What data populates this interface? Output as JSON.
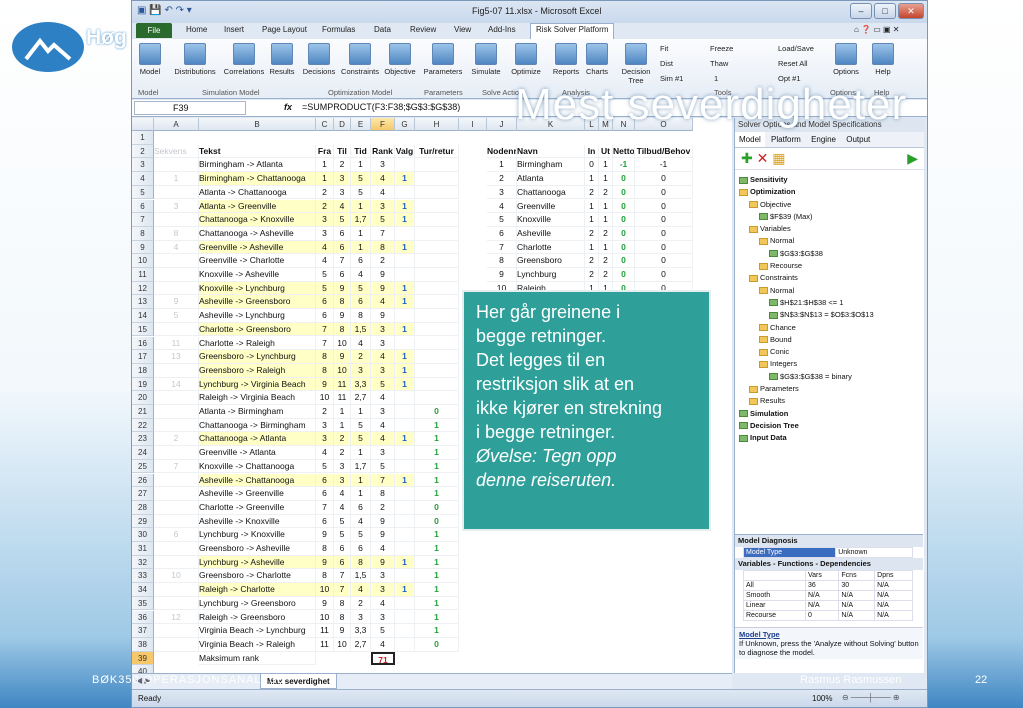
{
  "slide": {
    "brand": "Høg",
    "brand_sub": "Vitenskap",
    "title": "Mest severdigheter",
    "footer_left": "BØK350 OPERASJONSANALYSE",
    "footer_right": "Rasmus Rasmussen",
    "page": "22"
  },
  "window": {
    "title": "Fig5-07 11.xlsx - Microsoft Excel"
  },
  "tabs": [
    "File",
    "Home",
    "Insert",
    "Page Layout",
    "Formulas",
    "Data",
    "Review",
    "View",
    "Add-Ins",
    "Risk Solver Platform"
  ],
  "ribbon": {
    "buttons": [
      "Model",
      "Distributions",
      "Correlations",
      "Results",
      "Decisions",
      "Constraints",
      "Objective",
      "Parameters",
      "Simulate",
      "Optimize",
      "Reports",
      "Charts",
      "Decision Tree",
      "Options",
      "Help"
    ],
    "groups": [
      "Model",
      "Simulation Model",
      "Optimization Model",
      "Parameters",
      "Solve Action",
      "Analysis",
      "Tools",
      "Options",
      "Help"
    ],
    "small": [
      "Fit",
      "Dist",
      "Sim #1",
      "Freeze",
      "Thaw",
      "1",
      "Load/Save",
      "Reset All",
      "Opt #1"
    ]
  },
  "formula_bar": {
    "name_box": "F39",
    "formula": "=SUMPRODUCT(F3:F38;$G$3:$G$38)"
  },
  "columns": [
    "A",
    "B",
    "C",
    "D",
    "E",
    "F",
    "G",
    "H",
    "I",
    "J",
    "K",
    "L",
    "M",
    "N",
    "O"
  ],
  "left_header": {
    "a": "Sekvens",
    "text": "Tekst",
    "fra": "Fra",
    "til": "Til",
    "tid": "Tid",
    "rank": "Rank",
    "valg": "Valg",
    "tur": "Tur/retur"
  },
  "right_header": {
    "nodenr": "Nodenr",
    "navn": "Navn",
    "in": "In",
    "ut": "Ut",
    "netto": "Netto",
    "tilbud": "Tilbud/Behov"
  },
  "rows": [
    [
      "",
      "Birmingham -> Atlanta",
      "1",
      "2",
      "1",
      "3",
      "",
      "",
      false
    ],
    [
      "1",
      "Birmingham -> Chattanooga",
      "1",
      "3",
      "5",
      "4",
      "1",
      "",
      true
    ],
    [
      "",
      "Atlanta -> Chattanooga",
      "2",
      "3",
      "5",
      "4",
      "",
      "",
      false
    ],
    [
      "3",
      "Atlanta -> Greenville",
      "2",
      "4",
      "1",
      "3",
      "1",
      "",
      true
    ],
    [
      "",
      "Chattanooga -> Knoxville",
      "3",
      "5",
      "1,7",
      "5",
      "1",
      "",
      true
    ],
    [
      "8",
      "Chattanooga -> Asheville",
      "3",
      "6",
      "1",
      "7",
      "",
      "",
      false
    ],
    [
      "4",
      "Greenville -> Asheville",
      "4",
      "6",
      "1",
      "8",
      "1",
      "",
      true
    ],
    [
      "",
      "Greenville -> Charlotte",
      "4",
      "7",
      "6",
      "2",
      "",
      "",
      false
    ],
    [
      "",
      "Knoxville -> Asheville",
      "5",
      "6",
      "4",
      "9",
      "",
      "",
      false
    ],
    [
      "",
      "Knoxville -> Lynchburg",
      "5",
      "9",
      "5",
      "9",
      "1",
      "",
      true
    ],
    [
      "9",
      "Asheville -> Greensboro",
      "6",
      "8",
      "6",
      "4",
      "1",
      "",
      true
    ],
    [
      "5",
      "Asheville -> Lynchburg",
      "6",
      "9",
      "8",
      "9",
      "",
      "",
      false
    ],
    [
      "",
      "Charlotte -> Greensboro",
      "7",
      "8",
      "1,5",
      "3",
      "1",
      "",
      true
    ],
    [
      "11",
      "Charlotte -> Raleigh",
      "7",
      "10",
      "4",
      "3",
      "",
      "",
      false
    ],
    [
      "13",
      "Greensboro -> Lynchburg",
      "8",
      "9",
      "2",
      "4",
      "1",
      "",
      true
    ],
    [
      "",
      "Greensboro -> Raleigh",
      "8",
      "10",
      "3",
      "3",
      "1",
      "",
      true
    ],
    [
      "14",
      "Lynchburg -> Virginia Beach",
      "9",
      "11",
      "3,3",
      "5",
      "1",
      "",
      true
    ],
    [
      "",
      "Raleigh -> Virginia Beach",
      "10",
      "11",
      "2,7",
      "4",
      "",
      "",
      false
    ],
    [
      "",
      "Atlanta -> Birmingham",
      "2",
      "1",
      "1",
      "3",
      "",
      "0",
      false
    ],
    [
      "",
      "Chattanooga -> Birmingham",
      "3",
      "1",
      "5",
      "4",
      "",
      "1",
      false
    ],
    [
      "2",
      "Chattanooga -> Atlanta",
      "3",
      "2",
      "5",
      "4",
      "1",
      "1",
      true
    ],
    [
      "",
      "Greenville -> Atlanta",
      "4",
      "2",
      "1",
      "3",
      "",
      "1",
      false
    ],
    [
      "7",
      "Knoxville -> Chattanooga",
      "5",
      "3",
      "1,7",
      "5",
      "",
      "1",
      false
    ],
    [
      "",
      "Asheville -> Chattanooga",
      "6",
      "3",
      "1",
      "7",
      "1",
      "1",
      true
    ],
    [
      "",
      "Asheville -> Greenville",
      "6",
      "4",
      "1",
      "8",
      "",
      "1",
      false
    ],
    [
      "",
      "Charlotte -> Greenville",
      "7",
      "4",
      "6",
      "2",
      "",
      "0",
      false
    ],
    [
      "",
      "Asheville -> Knoxville",
      "6",
      "5",
      "4",
      "9",
      "",
      "0",
      false
    ],
    [
      "6",
      "Lynchburg -> Knoxville",
      "9",
      "5",
      "5",
      "9",
      "",
      "1",
      false
    ],
    [
      "",
      "Greensboro -> Asheville",
      "8",
      "6",
      "6",
      "4",
      "",
      "1",
      false
    ],
    [
      "",
      "Lynchburg -> Asheville",
      "9",
      "6",
      "8",
      "9",
      "1",
      "1",
      true
    ],
    [
      "10",
      "Greensboro -> Charlotte",
      "8",
      "7",
      "1,5",
      "3",
      "",
      "1",
      false
    ],
    [
      "",
      "Raleigh -> Charlotte",
      "10",
      "7",
      "4",
      "3",
      "1",
      "1",
      true
    ],
    [
      "",
      "Lynchburg -> Greensboro",
      "9",
      "8",
      "2",
      "4",
      "",
      "1",
      false
    ],
    [
      "12",
      "Raleigh -> Greensboro",
      "10",
      "8",
      "3",
      "3",
      "",
      "1",
      false
    ],
    [
      "",
      "Virginia Beach -> Lynchburg",
      "11",
      "9",
      "3,3",
      "5",
      "",
      "1",
      false
    ],
    [
      "",
      "Virginia Beach -> Raleigh",
      "11",
      "10",
      "2,7",
      "4",
      "",
      "0",
      false
    ]
  ],
  "total_row": {
    "label": "Maksimum rank",
    "value": "71"
  },
  "nodes": [
    [
      "1",
      "Birmingham",
      "0",
      "1",
      "-1",
      "-1"
    ],
    [
      "2",
      "Atlanta",
      "1",
      "1",
      "0",
      "0"
    ],
    [
      "3",
      "Chattanooga",
      "2",
      "2",
      "0",
      "0"
    ],
    [
      "4",
      "Greenville",
      "1",
      "1",
      "0",
      "0"
    ],
    [
      "5",
      "Knoxville",
      "1",
      "1",
      "0",
      "0"
    ],
    [
      "6",
      "Asheville",
      "2",
      "2",
      "0",
      "0"
    ],
    [
      "7",
      "Charlotte",
      "1",
      "1",
      "0",
      "0"
    ],
    [
      "8",
      "Greensboro",
      "2",
      "2",
      "0",
      "0"
    ],
    [
      "9",
      "Lynchburg",
      "2",
      "2",
      "0",
      "0"
    ],
    [
      "10",
      "Raleigh",
      "1",
      "1",
      "0",
      "0"
    ],
    [
      "11",
      "Virginia Beach",
      "1",
      "0",
      "1",
      "1"
    ]
  ],
  "callout": {
    "lines": [
      "Her går greinene i",
      "begge retninger.",
      "Det legges til en",
      "restriksjon slik at en",
      "ikke kjører en strekning",
      "i begge retninger."
    ],
    "italic": [
      "Øvelse: Tegn opp",
      "denne reiseruten."
    ]
  },
  "taskpane": {
    "header": "Solver Options and Model Specifications",
    "tabs": [
      "Model",
      "Platform",
      "Engine",
      "Output"
    ],
    "tree": [
      "Sensitivity",
      "Optimization",
      "Objective",
      "$F$39 (Max)",
      "Variables",
      "Normal",
      "$G$3:$G$38",
      "Recourse",
      "Constraints",
      "Normal",
      "$H$21:$H$38 <= 1",
      "$N$3:$N$13 = $O$3:$O$13",
      "Chance",
      "Bound",
      "Conic",
      "Integers",
      "$G$3:$G$38 = binary",
      "Parameters",
      "Results",
      "Simulation",
      "Decision Tree",
      "Input Data"
    ],
    "diag_title": "Model Diagnosis",
    "model_type_label": "Model Type",
    "model_type_value": "Unknown",
    "vf_title": "Variables - Functions - Dependencies",
    "vf_cols": [
      "",
      "Vars",
      "Fcns",
      "Dpns"
    ],
    "vf_rows": [
      [
        "All",
        "36",
        "30",
        "N/A"
      ],
      [
        "Smooth",
        "N/A",
        "N/A",
        "N/A"
      ],
      [
        "Linear",
        "N/A",
        "N/A",
        "N/A"
      ],
      [
        "Recourse",
        "0",
        "N/A",
        "N/A"
      ]
    ],
    "help_title": "Model Type",
    "help_text": "If Unknown, press the 'Analyze without Solving' button to diagnose the model."
  },
  "sheet_tabs": [
    "Max severdighet"
  ],
  "status": {
    "ready": "Ready",
    "zoom": "100%"
  }
}
